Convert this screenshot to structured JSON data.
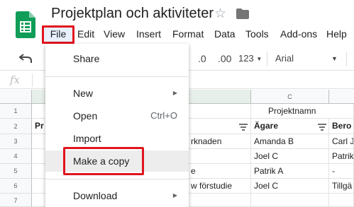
{
  "app": {
    "title": "Projektplan och aktiviteter",
    "star_icon": "star-icon",
    "folder_icon": "folder-icon",
    "logo_icon": "sheets-logo-icon"
  },
  "menubar": {
    "items": [
      "File",
      "Edit",
      "View",
      "Insert",
      "Format",
      "Data",
      "Tools",
      "Add-ons",
      "Help"
    ],
    "active": "File"
  },
  "toolbar": {
    "undo_icon": "undo-icon",
    "decrease_decimal": ".0",
    "increase_decimal": ".00",
    "number_format": "123",
    "font": "Arial"
  },
  "formula_bar": {
    "fx": "fx"
  },
  "grid": {
    "col_c_label": "C",
    "row_numbers": [
      "1",
      "2",
      "3",
      "4",
      "5",
      "6",
      "7"
    ],
    "row1_c": "Projektnamn",
    "row2_b_partial": "Pr",
    "row2_c": "Ägare",
    "row2_d_partial": "Bero",
    "rows": [
      {
        "b": "rknaden",
        "c": "Amanda B",
        "d": "Carl J"
      },
      {
        "b": "",
        "c": "Joel C",
        "d": "Patrik"
      },
      {
        "b": "e",
        "c": "Patrik A",
        "d": "-"
      },
      {
        "b": "w förstudie",
        "c": "Joel C",
        "d": "Tillgä"
      }
    ]
  },
  "file_menu": {
    "share": "Share",
    "new": "New",
    "open": "Open",
    "open_shortcut": "Ctrl+O",
    "import": "Import",
    "make_copy": "Make a copy",
    "download": "Download",
    "submenu_arrow": "▶"
  },
  "colors": {
    "highlight_red": "#e1141e",
    "sheets_green": "#0f9d58"
  }
}
